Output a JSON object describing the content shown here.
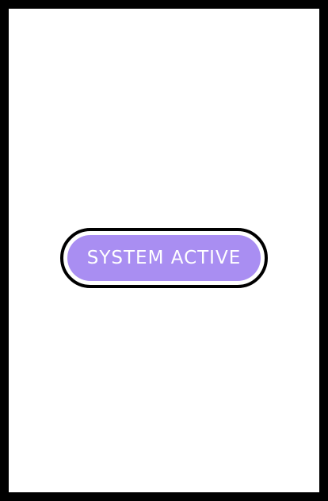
{
  "status_button": {
    "label": "SYSTEM ACTIVE"
  },
  "colors": {
    "frame_border": "#000000",
    "background": "#ffffff",
    "pill_fill": "#a98ef2",
    "pill_text": "#ffffff",
    "pill_outline": "#000000"
  }
}
